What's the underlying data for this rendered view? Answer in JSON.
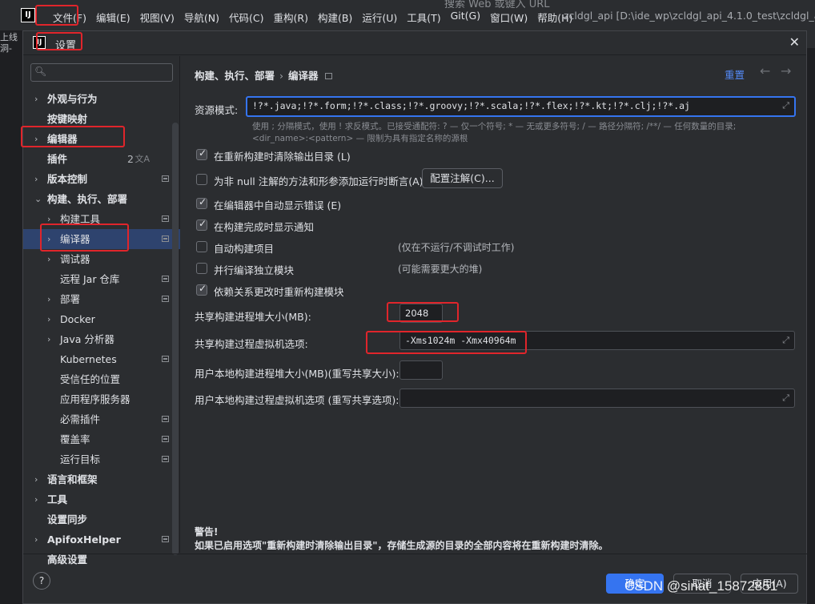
{
  "ide": {
    "logo": "IJ",
    "menu": [
      "文件(F)",
      "编辑(E)",
      "视图(V)",
      "导航(N)",
      "代码(C)",
      "重构(R)",
      "构建(B)",
      "运行(U)",
      "工具(T)",
      "Git(G)",
      "窗口(W)",
      "帮助(H)"
    ],
    "window_title": "zcldgl_api [D:\\ide_wp\\zcldgl_api_4.1.0_test\\zcldgl_api]",
    "background_search_hint": "搜索 Web 或键入 URL",
    "left_strip_text": [
      "上线",
      "洞-"
    ]
  },
  "dialog": {
    "title": "设置",
    "close_icon": "close-icon"
  },
  "sidebar": {
    "search_placeholder": "",
    "items": [
      {
        "label": "外观与行为",
        "arrow": "›",
        "level": 0,
        "bold": true
      },
      {
        "label": "按键映射",
        "arrow": "",
        "level": 0,
        "bold": true
      },
      {
        "label": "编辑器",
        "arrow": "›",
        "level": 0,
        "bold": true
      },
      {
        "label": "插件",
        "arrow": "",
        "level": 0,
        "bold": true,
        "badge": "2"
      },
      {
        "label": "版本控制",
        "arrow": "›",
        "level": 0,
        "bold": true,
        "module": true
      },
      {
        "label": "构建、执行、部署",
        "arrow": "⌄",
        "level": 0,
        "bold": true
      },
      {
        "label": "构建工具",
        "arrow": "›",
        "level": 1,
        "module": true
      },
      {
        "label": "编译器",
        "arrow": "›",
        "level": 1,
        "module": true,
        "selected": true
      },
      {
        "label": "调试器",
        "arrow": "›",
        "level": 1
      },
      {
        "label": "远程 Jar 仓库",
        "arrow": "",
        "level": 1,
        "module": true
      },
      {
        "label": "部署",
        "arrow": "›",
        "level": 1,
        "module": true
      },
      {
        "label": "Docker",
        "arrow": "›",
        "level": 1
      },
      {
        "label": "Java 分析器",
        "arrow": "›",
        "level": 1
      },
      {
        "label": "Kubernetes",
        "arrow": "",
        "level": 1,
        "module": true
      },
      {
        "label": "受信任的位置",
        "arrow": "",
        "level": 1
      },
      {
        "label": "应用程序服务器",
        "arrow": "",
        "level": 1
      },
      {
        "label": "必需插件",
        "arrow": "",
        "level": 1,
        "module": true
      },
      {
        "label": "覆盖率",
        "arrow": "",
        "level": 1,
        "module": true
      },
      {
        "label": "运行目标",
        "arrow": "",
        "level": 1,
        "module": true
      },
      {
        "label": "语言和框架",
        "arrow": "›",
        "level": 0,
        "bold": true
      },
      {
        "label": "工具",
        "arrow": "›",
        "level": 0,
        "bold": true
      },
      {
        "label": "设置同步",
        "arrow": "",
        "level": 0,
        "bold": true
      },
      {
        "label": "ApifoxHelper",
        "arrow": "›",
        "level": 0,
        "bold": true,
        "module": true
      },
      {
        "label": "高级设置",
        "arrow": "",
        "level": 0,
        "bold": true
      }
    ]
  },
  "main": {
    "breadcrumb": {
      "parent": "构建、执行、部署",
      "sep": "›",
      "current": "编译器"
    },
    "reset": "重置",
    "back_icon": "←",
    "forward_icon": "→",
    "resource_label": "资源模式:",
    "resource_value": "!?*.java;!?*.form;!?*.class;!?*.groovy;!?*.scala;!?*.flex;!?*.kt;!?*.clj;!?*.aj",
    "hint_line1": "使用 ; 分隔模式，使用 ! 求反模式。已接受通配符: ? — 仅一个符号; * — 无或更多符号; / — 路径分隔符; /**/ — 任何数量的目录;",
    "hint_line2": "<dir_name>:<pattern> — 限制为具有指定名称的源根",
    "checkboxes": [
      {
        "label": "在重新构建时清除输出目录 (L)",
        "checked": true
      },
      {
        "label": "为非 null 注解的方法和形参添加运行时断言(A)",
        "checked": false
      },
      {
        "label": "在编辑器中自动显示错误 (E)",
        "checked": true
      },
      {
        "label": "在构建完成时显示通知",
        "checked": true
      },
      {
        "label": "自动构建项目",
        "checked": false
      },
      {
        "label": "并行编译独立模块",
        "checked": false
      },
      {
        "label": "依赖关系更改时重新构建模块",
        "checked": true
      }
    ],
    "configure_button": "配置注解(C)...",
    "note_auto_build": "(仅在不运行/不调试时工作)",
    "note_parallel": "(可能需要更大的堆)",
    "heap_label": "共享构建进程堆大小(MB):",
    "heap_value": "2048",
    "vm_label": "共享构建过程虚拟机选项:",
    "vm_value": "-Xms1024m -Xmx40964m",
    "user_heap_label": "用户本地构建进程堆大小(MB)(重写共享大小):",
    "user_heap_value": "",
    "user_vm_label": "用户本地构建过程虚拟机选项 (重写共享选项):",
    "user_vm_value": "",
    "expand_icon": "⤢",
    "warning_title": "警告!",
    "warning_text": "如果已启用选项\"重新构建时清除输出目录\"，存储生成源的目录的全部内容将在重新构建时清除。"
  },
  "footer": {
    "help": "?",
    "ok": "确定",
    "cancel": "取消",
    "apply": "应用(A)"
  },
  "watermark": "CSDN @sinat_15872851",
  "colors": {
    "accent": "#3574f0",
    "selection": "#2e436e",
    "annotation": "#e0252b",
    "link": "#548af7"
  }
}
